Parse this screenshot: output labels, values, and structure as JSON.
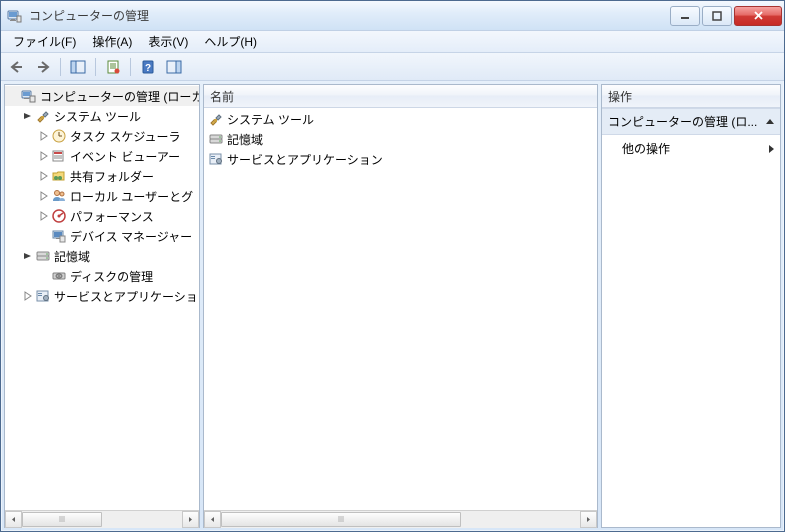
{
  "titlebar": {
    "title": "コンピューターの管理"
  },
  "menubar": {
    "file": "ファイル(F)",
    "action": "操作(A)",
    "view": "表示(V)",
    "help": "ヘルプ(H)"
  },
  "tree": {
    "root": "コンピューターの管理 (ローカ",
    "systemTools": "システム ツール",
    "taskScheduler": "タスク スケジューラ",
    "eventViewer": "イベント ビューアー",
    "sharedFolders": "共有フォルダー",
    "localUsers": "ローカル ユーザーとグ",
    "performance": "パフォーマンス",
    "deviceManager": "デバイス マネージャー",
    "storage": "記憶域",
    "diskMgmt": "ディスクの管理",
    "services": "サービスとアプリケーショ"
  },
  "middle": {
    "header": "名前",
    "items": {
      "systemTools": "システム ツール",
      "storage": "記憶域",
      "services": "サービスとアプリケーション"
    }
  },
  "right": {
    "header": "操作",
    "group": "コンピューターの管理 (ロ...",
    "otherActions": "他の操作"
  }
}
